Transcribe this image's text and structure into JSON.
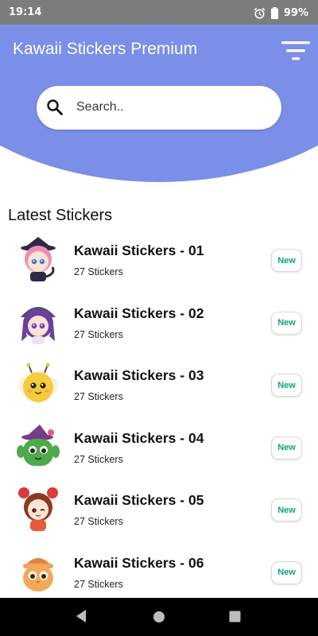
{
  "status_bar": {
    "time": "19:14",
    "battery": "99%",
    "icons": [
      "alarm-icon",
      "battery-icon"
    ]
  },
  "header": {
    "title": "Kawaii Stickers Premium",
    "menu_icon": "filter-menu-icon",
    "background": "#7b8ee8"
  },
  "search": {
    "placeholder": "Search..",
    "value": "",
    "icon": "search-icon"
  },
  "section": {
    "title": "Latest Stickers"
  },
  "stickers": [
    {
      "title": "Kawaii Stickers - 01",
      "count": "27 Stickers",
      "badge": "New",
      "thumb": "cat-witch-girl-sticker"
    },
    {
      "title": "Kawaii Stickers - 02",
      "count": "27 Stickers",
      "badge": "New",
      "thumb": "purple-hair-girl-sticker"
    },
    {
      "title": "Kawaii Stickers - 03",
      "count": "27 Stickers",
      "badge": "New",
      "thumb": "yellow-bug-sticker"
    },
    {
      "title": "Kawaii Stickers - 04",
      "count": "27 Stickers",
      "badge": "New",
      "thumb": "cactus-witch-sticker"
    },
    {
      "title": "Kawaii Stickers - 05",
      "count": "27 Stickers",
      "badge": "New",
      "thumb": "red-bun-girl-sticker"
    },
    {
      "title": "Kawaii Stickers - 06",
      "count": "27 Stickers",
      "badge": "New",
      "thumb": "orange-owl-sticker"
    }
  ],
  "colors": {
    "accent": "#7b8ee8",
    "badge_text": "#16a07f"
  },
  "nav_bar": {
    "buttons": [
      "back-icon",
      "home-icon",
      "recents-icon"
    ]
  }
}
